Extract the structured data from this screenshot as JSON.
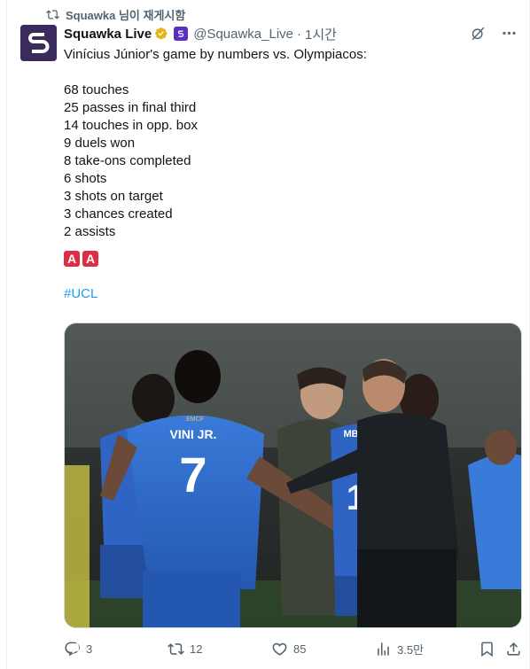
{
  "retweet": {
    "label": "Squawka 님이 재게시함"
  },
  "author": {
    "name": "Squawka Live",
    "handle": "@Squawka_Live",
    "separator": "·",
    "time": "1시간"
  },
  "tweet": {
    "intro": "Vinícius Júnior's game by numbers vs. Olympiacos:",
    "stats": [
      "68 touches",
      "25 passes in final third",
      "14 touches in opp. box",
      "9 duels won",
      "8 take-ons completed",
      "6 shots",
      "3 shots on target",
      "3 chances created",
      "2 assists"
    ],
    "emoji": [
      "A",
      "A"
    ],
    "hashtag": "#UCL"
  },
  "photo": {
    "jersey_name": "VINI JR.",
    "jersey_number": "7",
    "jersey_number_2": "10",
    "jersey_name_2": "MBAPPÉ",
    "sponsor": "EMCF"
  },
  "actions": {
    "replies": "3",
    "reposts": "12",
    "likes": "85",
    "views": "3.5만"
  },
  "colors": {
    "accent": "#1d9bf0",
    "secondary_text": "#536471",
    "primary_text": "#0f1419",
    "avatar_bg": "#3b2a5c",
    "emoji_red": "#dd2e44"
  }
}
